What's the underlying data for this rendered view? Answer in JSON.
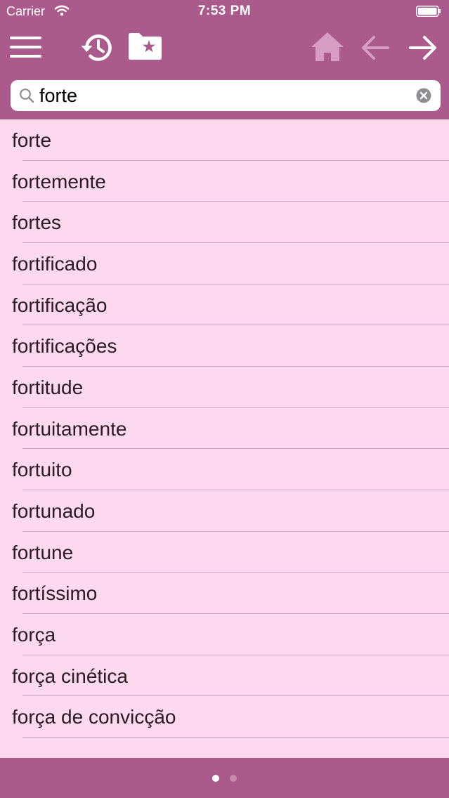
{
  "status_bar": {
    "carrier": "Carrier",
    "time": "7:53 PM"
  },
  "toolbar": {
    "icons": [
      "menu-icon",
      "history-icon",
      "favorites-folder-icon",
      "home-icon",
      "back-arrow-icon",
      "forward-arrow-icon"
    ],
    "bar_color": "#ab5a8c",
    "disabled_icon_color": "#d79cc4"
  },
  "search": {
    "value": "forte",
    "placeholder": ""
  },
  "results": [
    {
      "word": "forte"
    },
    {
      "word": "fortemente"
    },
    {
      "word": "fortes"
    },
    {
      "word": "fortificado"
    },
    {
      "word": "fortificação"
    },
    {
      "word": "fortificações"
    },
    {
      "word": "fortitude"
    },
    {
      "word": "fortuitamente"
    },
    {
      "word": "fortuito"
    },
    {
      "word": "fortunado"
    },
    {
      "word": "fortune"
    },
    {
      "word": "fortíssimo"
    },
    {
      "word": "força"
    },
    {
      "word": "força cinética"
    },
    {
      "word": "força de convicção"
    }
  ],
  "list_background": "#fdd9ef",
  "page_indicator": {
    "total": 2,
    "current": 1
  }
}
